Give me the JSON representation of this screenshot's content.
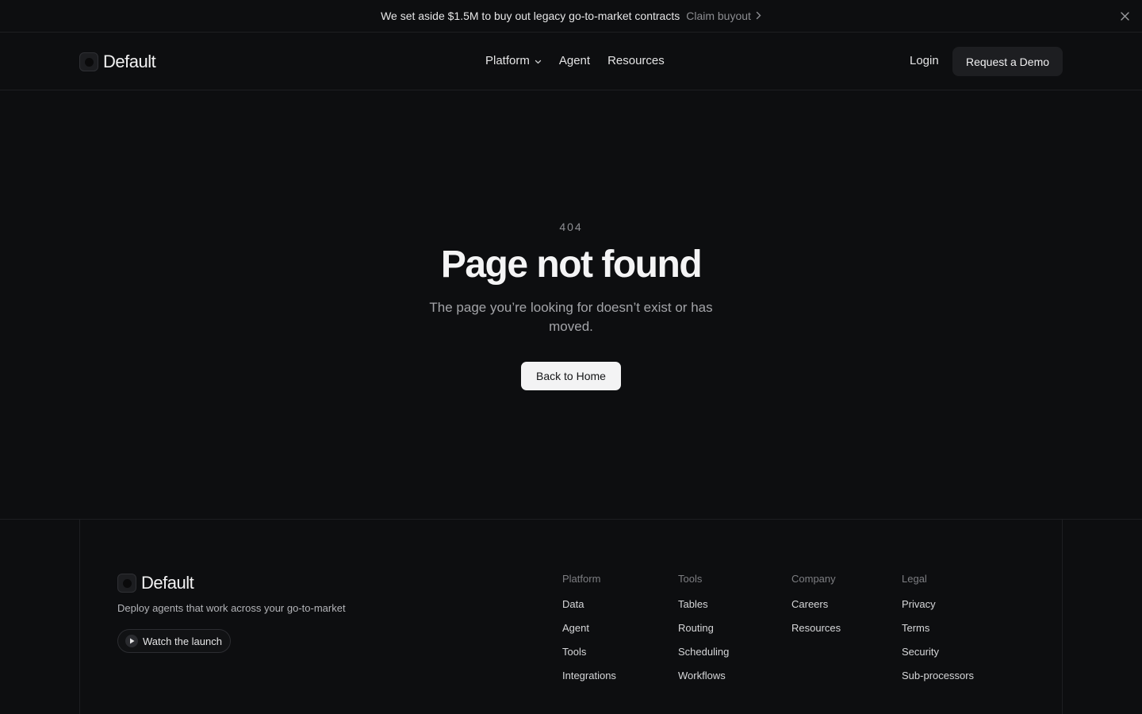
{
  "announcement": {
    "message": "We set aside $1.5M to buy out legacy go-to-market contracts",
    "cta_label": "Claim buyout"
  },
  "header": {
    "brand": "Default",
    "nav": [
      {
        "label": "Platform",
        "has_dropdown": true
      },
      {
        "label": "Agent"
      },
      {
        "label": "Resources"
      }
    ],
    "login_label": "Login",
    "demo_label": "Request a Demo"
  },
  "error": {
    "code": "404",
    "title": "Page not found",
    "description": "The page you’re looking for doesn’t exist or has moved.",
    "button_label": "Back to Home"
  },
  "footer": {
    "brand": "Default",
    "tagline": "Deploy agents that work across your go-to-market",
    "watch_label": "Watch the launch",
    "columns": [
      {
        "heading": "Platform",
        "links": [
          "Data",
          "Agent",
          "Tools",
          "Integrations"
        ]
      },
      {
        "heading": "Tools",
        "links": [
          "Tables",
          "Routing",
          "Scheduling",
          "Workflows"
        ]
      },
      {
        "heading": "Company",
        "links": [
          "Careers",
          "Resources"
        ]
      },
      {
        "heading": "Legal",
        "links": [
          "Privacy",
          "Terms",
          "Security",
          "Sub-processors"
        ]
      }
    ]
  },
  "colors": {
    "background": "#0d0e10",
    "primary_button": "#f3f3f4",
    "secondary_button": "#1d1e21",
    "muted_text": "#8e8f93"
  },
  "icons": [
    "chevron-right-icon",
    "close-icon",
    "chevron-down-icon",
    "logo-mark-icon",
    "play-icon"
  ]
}
